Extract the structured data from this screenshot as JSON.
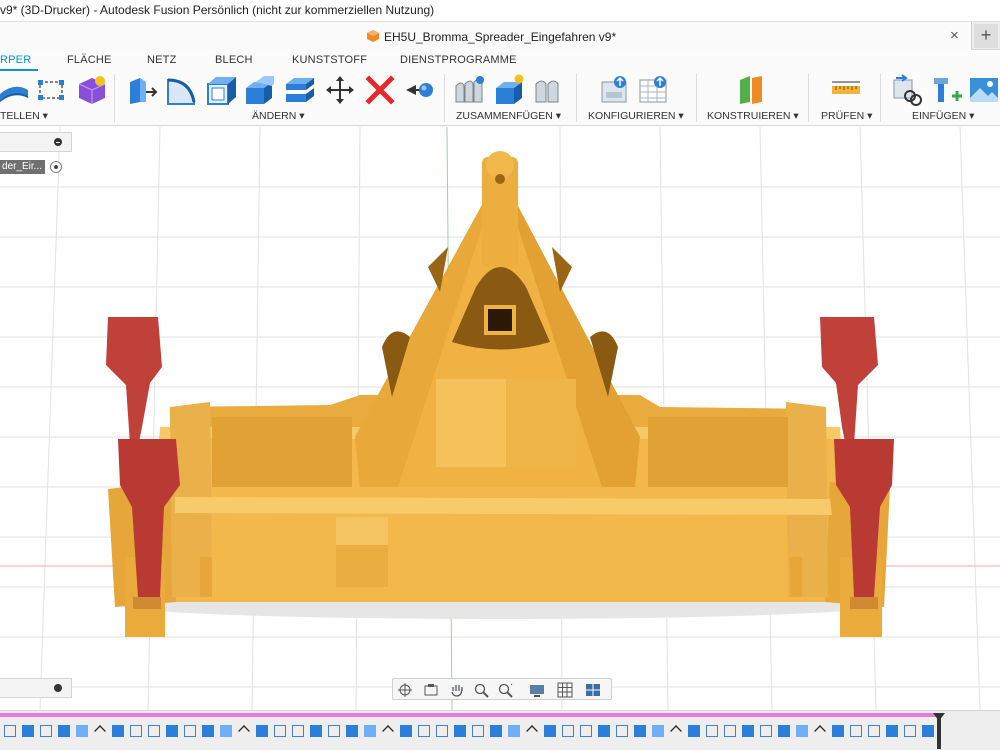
{
  "window": {
    "title": "v9* (3D-Drucker) - Autodesk Fusion Persönlich (nicht zur kommerziellen Nutzung)"
  },
  "document_tab": {
    "name": "EH5U_Bromma_Spreader_Eingefahren v9*",
    "close": "×",
    "new_tab": "+"
  },
  "ribbon": {
    "tabs": [
      "RPER",
      "FLÄCHE",
      "NETZ",
      "BLECH",
      "KUNSTSTOFF",
      "DIENSTPROGRAMME"
    ],
    "active_tab": "RPER",
    "groups": {
      "create": "TELLEN ▾",
      "modify": "ÄNDERN ▾",
      "assemble": "ZUSAMMENFÜGEN ▾",
      "configure": "KONFIGURIEREN ▾",
      "construct": "KONSTRUIEREN ▾",
      "inspect": "PRÜFEN ▾",
      "insert": "EINFÜGEN ▾"
    }
  },
  "browser": {
    "item_label": "der_Eir..."
  },
  "colors": {
    "accent": "#0696d7",
    "body_yellow": "#f2b84b",
    "parts_red": "#c0413a",
    "timeline_track": "#e97ad9"
  },
  "navbar": {
    "icons": [
      "orbit-icon",
      "look-at-icon",
      "pan-icon",
      "zoom-icon",
      "fit-icon",
      "display-settings-icon",
      "grid-icon",
      "viewports-icon"
    ]
  }
}
